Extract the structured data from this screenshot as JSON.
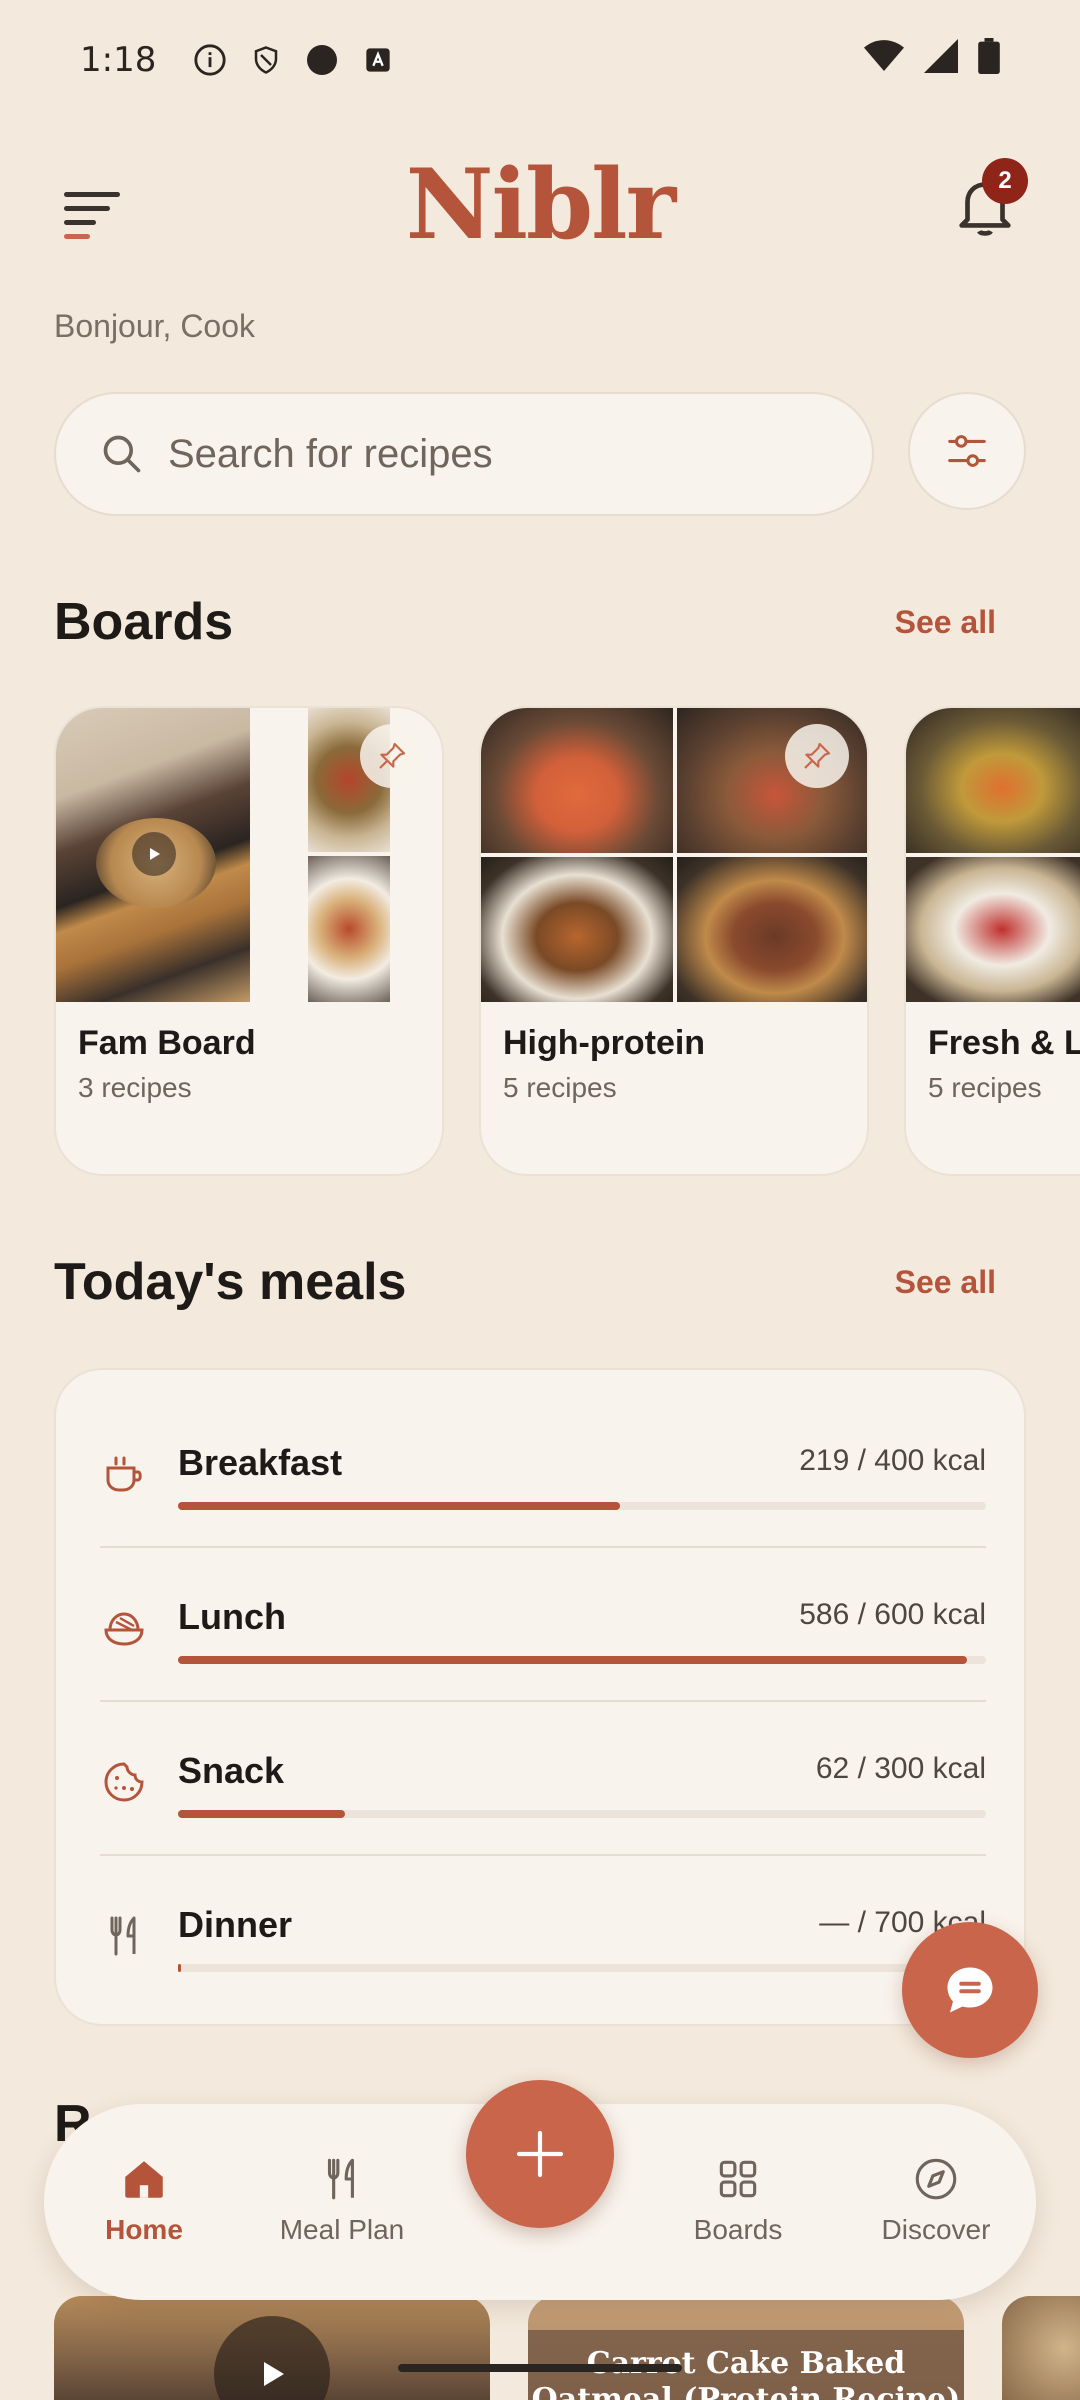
{
  "status_bar": {
    "time": "1:18"
  },
  "app": {
    "logo": "Niblr",
    "notifications_count": "2"
  },
  "greeting": "Bonjour, Cook",
  "search": {
    "placeholder": "Search for recipes"
  },
  "boards_section": {
    "title": "Boards",
    "see_all": "See all",
    "items": [
      {
        "name": "Fam Board",
        "count": "3 recipes"
      },
      {
        "name": "High-protein",
        "count": "5 recipes"
      },
      {
        "name": "Fresh & Li",
        "count": "5 recipes"
      }
    ]
  },
  "meals_section": {
    "title": "Today's meals",
    "see_all": "See all",
    "meals": [
      {
        "name": "Breakfast",
        "kcal": "219 / 400 kcal",
        "progress": 0.5475,
        "icon": "coffee-cup-icon"
      },
      {
        "name": "Lunch",
        "kcal": "586 / 600 kcal",
        "progress": 0.9767,
        "icon": "bowl-icon"
      },
      {
        "name": "Snack",
        "kcal": "62 / 300 kcal",
        "progress": 0.2067,
        "icon": "cookie-icon"
      },
      {
        "name": "Dinner",
        "kcal": "— / 700 kcal",
        "progress": 0,
        "icon": "fork-knife-icon"
      }
    ]
  },
  "peek": {
    "heading_start": "R",
    "card_title": "Carrot Cake Baked Oatmeal (Protein Recipe)"
  },
  "bottom_nav": {
    "items": [
      {
        "label": "Home",
        "icon": "home-icon",
        "active": true
      },
      {
        "label": "Meal Plan",
        "icon": "fork-knife-icon",
        "active": false
      },
      {
        "label": "Boards",
        "icon": "grid-icon",
        "active": false
      },
      {
        "label": "Discover",
        "icon": "compass-icon",
        "active": false
      }
    ]
  },
  "colors": {
    "accent": "#b4543a",
    "background": "#f3e9dc",
    "card": "#f8f3ec",
    "badge": "#8f2418"
  }
}
